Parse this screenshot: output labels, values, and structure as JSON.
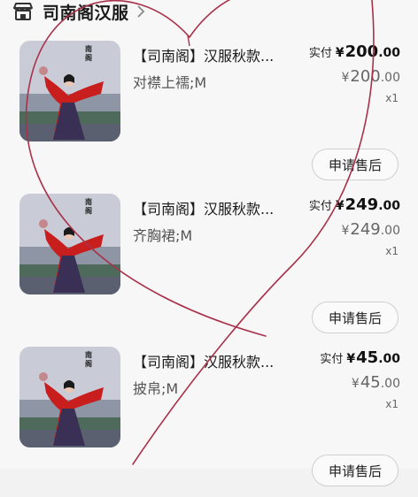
{
  "shop": {
    "name": "司南阁汉服"
  },
  "items": [
    {
      "title": "【司南阁】汉服秋款...",
      "spec": "对襟上襦;M",
      "paid_label": "实付",
      "currency": "¥",
      "paid_int": "200",
      "paid_dec": ".00",
      "orig_int": "200",
      "orig_dec": ".00",
      "quantity": "x1",
      "after_sale_label": "申请售后",
      "seal_text": "南\n阁"
    },
    {
      "title": "【司南阁】汉服秋款...",
      "spec": "齐胸裙;M",
      "paid_label": "实付",
      "currency": "¥",
      "paid_int": "249",
      "paid_dec": ".00",
      "orig_int": "249",
      "orig_dec": ".00",
      "quantity": "x1",
      "after_sale_label": "申请售后",
      "seal_text": "南\n阁"
    },
    {
      "title": "【司南阁】汉服秋款...",
      "spec": "披帛;M",
      "paid_label": "实付",
      "currency": "¥",
      "paid_int": "45",
      "paid_dec": ".00",
      "orig_int": "45",
      "orig_dec": ".00",
      "quantity": "x1",
      "after_sale_label": "申请售后",
      "seal_text": "南\n阁"
    }
  ],
  "colors": {
    "doodle_stroke": "#a8324a",
    "garment_red": "#c81e1e",
    "garment_dark": "#3a2f55"
  }
}
